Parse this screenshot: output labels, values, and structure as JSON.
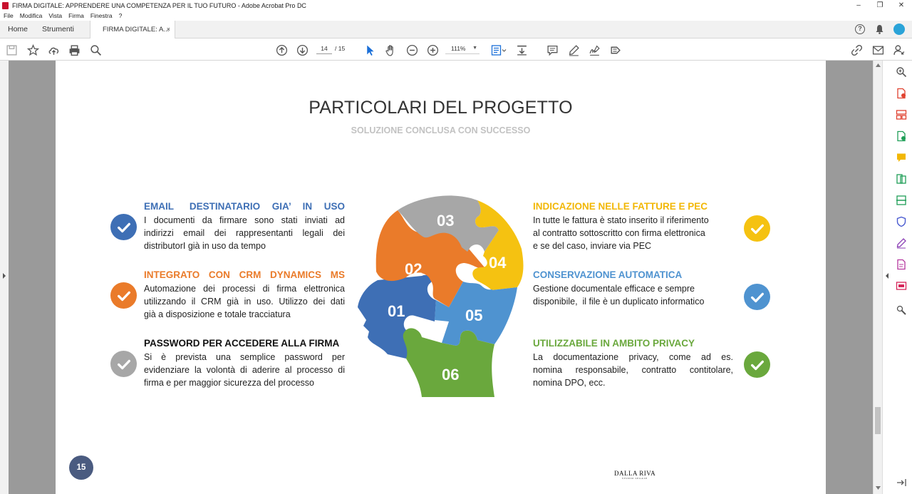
{
  "window": {
    "title": "FIRMA DIGITALE: APPRENDERE UNA COMPETENZA PER IL TUO FUTURO - Adobe Acrobat Pro DC"
  },
  "menu": [
    "File",
    "Modifica",
    "Vista",
    "Firma",
    "Finestra",
    "?"
  ],
  "tabs": {
    "home": "Home",
    "tools": "Strumenti",
    "doc": "FIRMA DIGITALE: A...",
    "close": "×"
  },
  "toolbar": {
    "current_page": "14",
    "total_pages": "/ 15",
    "zoom": "111%"
  },
  "slide": {
    "title": "PARTICOLARI DEL PROGETTO",
    "subtitle": "SOLUZIONE CONCLUSA CON SUCCESSO",
    "items": [
      {
        "title": "EMAIL    DESTINATARIO   GIA’   IN   USO",
        "body": [
          "I documenti da firmare sono stati inviati ad",
          "indirizzi email dei rappresentanti legali dei",
          "distributorI già in uso da tempo"
        ],
        "color": "#3e6fb5"
      },
      {
        "title": "INTEGRATO   CON   CRM   DYNAMICS   MS",
        "body": [
          "Automazione dei processi di firma elettronica",
          "utilizzando il CRM già in uso. Utilizzo dei dati",
          "già a disposizione e totale tracciatura"
        ],
        "color": "#ea7b2a"
      },
      {
        "title": "PASSWORD PER ACCEDERE ALLA FIRMA",
        "body": [
          "Si è prevista una semplice password per",
          "evidenziare la volontà di aderire al processo di",
          "firma e per maggior sicurezza del processo"
        ],
        "color": "#111111"
      },
      {
        "title": "INDICAZIONE  NELLE FATTURE E PEC",
        "body": [
          "In tutte le fattura è stato inserito il riferimento",
          "al contratto sottoscritto con firma elettronica",
          "e se del caso, inviare via PEC"
        ],
        "color": "#f2b705"
      },
      {
        "title": "CONSERVAZIONE AUTOMATICA",
        "body": [
          "Gestione documentale efficace e sempre",
          "disponibile,  il file è un duplicato informatico"
        ],
        "color": "#4f93d0"
      },
      {
        "title": "UTILIZZABILE IN AMBITO PRIVACY",
        "body": [
          "La documentazione privacy, come ad es.",
          "nomina responsabile, contratto contitolare,",
          "nomina DPO, ecc."
        ],
        "color": "#6aa83d"
      }
    ],
    "puzzle": {
      "p01": "01",
      "p02": "02",
      "p03": "03",
      "p04": "04",
      "p05": "05",
      "p06": "06"
    },
    "check_colors": {
      "blue": "#3e6fb5",
      "orange": "#ea7b2a",
      "gray": "#a7a7a7",
      "yellow": "#f5c211",
      "lightblue": "#4f93d0",
      "green": "#6aa83d"
    },
    "page_number": "15",
    "logo": "DALLA RIVA",
    "logo_small": "STUDIO LEGALE"
  }
}
